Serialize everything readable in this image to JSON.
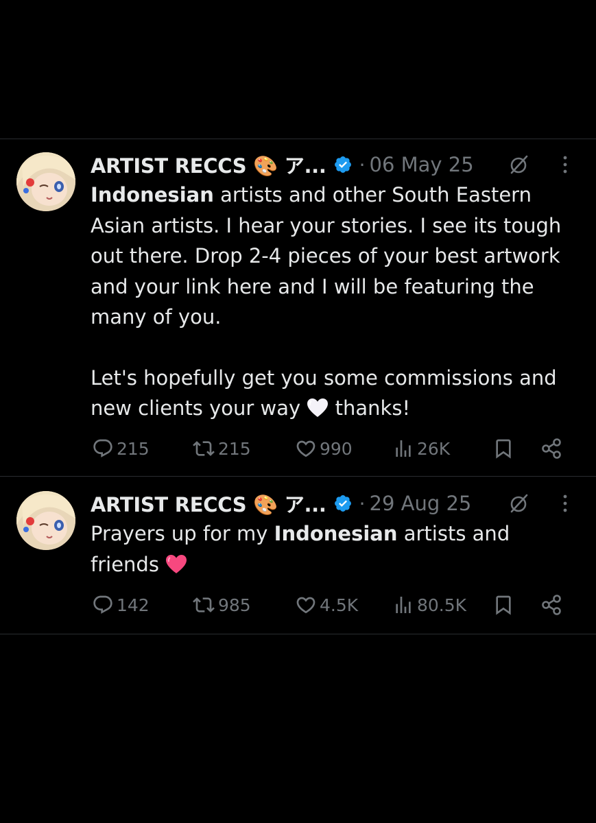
{
  "tweets": [
    {
      "author": "ARTIST RECCS 🎨 ア...",
      "separator": "·",
      "date": "06 May 25",
      "bold_word": "Indonesian",
      "paragraph1_rest": " artists and other South Eastern Asian artists. I hear your stories. I see its tough out there. Drop 2-4 pieces of your best artwork and your link here and I will be featuring the many of you.",
      "paragraph2_a": "Let's hopefully get you some commissions and new clients your way ",
      "paragraph2_emoji": "white-heart-emoji",
      "paragraph2_b": " thanks!",
      "replies": "215",
      "reposts": "215",
      "likes": "990",
      "views": "26K"
    },
    {
      "author": "ARTIST RECCS 🎨 ア...",
      "separator": "·",
      "date": "29 Aug 25",
      "text_a": "Prayers up for my ",
      "bold_word": "Indonesian",
      "text_b": " artists and friends ",
      "text_emoji": "pink-heart-emoji",
      "replies": "142",
      "reposts": "985",
      "likes": "4.5K",
      "views": "80.5K"
    }
  ],
  "colors": {
    "background": "#000000",
    "text": "#e7e9ea",
    "muted": "#71767b",
    "verified": "#1d9bf0",
    "divider": "#2a2d31",
    "pink_heart": "#f7487f"
  },
  "icons": [
    "reply-icon",
    "repost-icon",
    "like-icon",
    "views-icon",
    "bookmark-icon",
    "share-icon",
    "grok-icon",
    "more-icon",
    "verified-icon"
  ]
}
